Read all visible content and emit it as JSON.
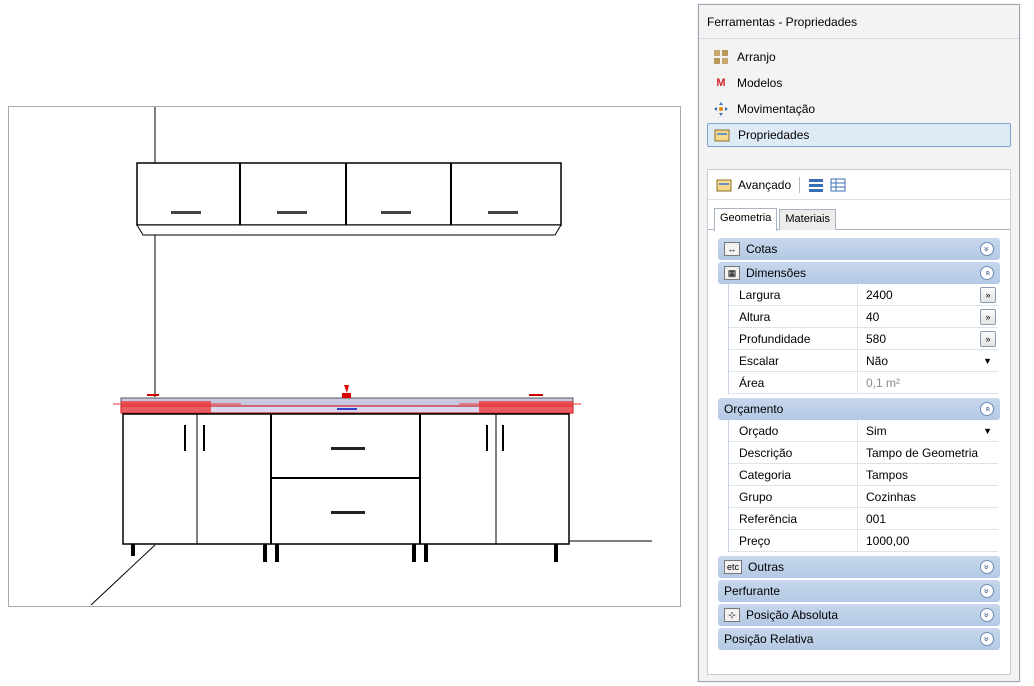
{
  "panel": {
    "title": "Ferramentas - Propriedades",
    "nav": [
      {
        "label": "Arranjo",
        "icon": "arrange-icon"
      },
      {
        "label": "Modelos",
        "icon": "models-icon"
      },
      {
        "label": "Movimentação",
        "icon": "move-icon"
      },
      {
        "label": "Propriedades",
        "icon": "properties-icon",
        "selected": true
      }
    ],
    "toolbar": {
      "label": "Avançado"
    },
    "tabs": [
      "Geometria",
      "Materiais"
    ],
    "groups": {
      "cotas": "Cotas",
      "dimensoes": "Dimensões",
      "orcamento": "Orçamento",
      "outras": "Outras",
      "perfurante": "Perfurante",
      "posicao_absoluta": "Posição Absoluta",
      "posicao_relativa": "Posição Relativa"
    },
    "outras_icon_text": "etc",
    "dimensoes": {
      "largura": {
        "label": "Largura",
        "value": "2400"
      },
      "altura": {
        "label": "Altura",
        "value": "40"
      },
      "profundidade": {
        "label": "Profundidade",
        "value": "580"
      },
      "escalar": {
        "label": "Escalar",
        "value": "Não"
      },
      "area": {
        "label": "Área",
        "value": "0,1 m²"
      }
    },
    "orcamento": {
      "orcado": {
        "label": "Orçado",
        "value": "Sim"
      },
      "descricao": {
        "label": "Descrição",
        "value": "Tampo de Geometria"
      },
      "categoria": {
        "label": "Categoria",
        "value": "Tampos"
      },
      "grupo": {
        "label": "Grupo",
        "value": "Cozinhas"
      },
      "referencia": {
        "label": "Referência",
        "value": "001"
      },
      "preco": {
        "label": "Preço",
        "value": "1000,00"
      }
    },
    "more_symbol": "»",
    "collapse_symbol": "»",
    "expand_symbol": "«"
  }
}
